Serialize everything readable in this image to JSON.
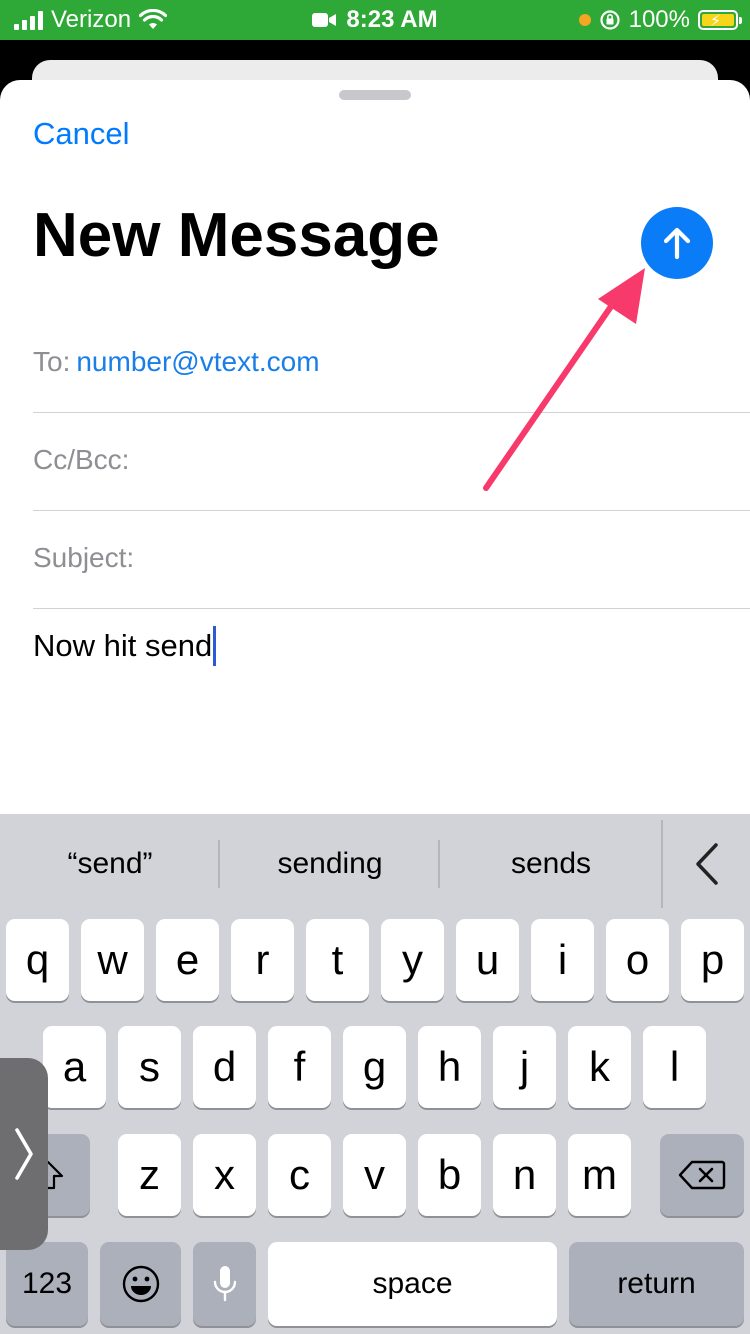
{
  "status_bar": {
    "carrier": "Verizon",
    "time": "8:23 AM",
    "battery": "100%"
  },
  "compose": {
    "cancel_label": "Cancel",
    "title": "New Message",
    "to_label": "To:",
    "to_value": "number@vtext.com",
    "ccbcc_label": "Cc/Bcc:",
    "subject_label": "Subject:",
    "body_text": "Now hit send"
  },
  "keyboard": {
    "predictions": [
      "“send”",
      "sending",
      "sends"
    ],
    "row1": [
      "q",
      "w",
      "e",
      "r",
      "t",
      "y",
      "u",
      "i",
      "o",
      "p"
    ],
    "row2": [
      "a",
      "s",
      "d",
      "f",
      "g",
      "h",
      "j",
      "k",
      "l"
    ],
    "row3": [
      "z",
      "x",
      "c",
      "v",
      "b",
      "n",
      "m"
    ],
    "numbers_label": "123",
    "space_label": "space",
    "return_label": "return"
  },
  "colors": {
    "status_bar": "#2ea836",
    "accent": "#007aff",
    "send_button": "#0a7cf7",
    "annotation_arrow": "#f7396b",
    "keyboard_bg": "#d1d3d9"
  },
  "icons": [
    "signal-icon",
    "wifi-icon",
    "video-camera-icon",
    "orientation-lock-icon",
    "battery-icon",
    "send-arrow-icon",
    "collapse-predictions-icon",
    "shift-icon",
    "delete-icon",
    "emoji-icon",
    "microphone-icon",
    "side-tab-chevron-icon"
  ]
}
